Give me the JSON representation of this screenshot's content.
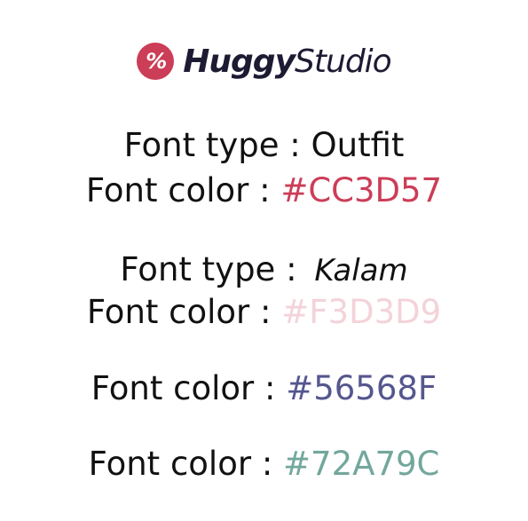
{
  "logo": {
    "icon": "huggy-logo-icon",
    "brand_bold": "Huggy",
    "brand_light": "Studio",
    "accent_color": "#CC3D57"
  },
  "specs": [
    {
      "label": "Font type :",
      "value": "Outfit"
    },
    {
      "label": "Font color :",
      "value": "#CC3D57",
      "color": "#CC3D57"
    },
    {
      "label": "Font type :",
      "value": "Kalam"
    },
    {
      "label": "Font color :",
      "value": "#F3D3D9",
      "color": "#F3D3D9"
    },
    {
      "label": "Font color :",
      "value": "#56568F",
      "color": "#56568F"
    },
    {
      "label": "Font color :",
      "value": "#72A79C",
      "color": "#72A79C"
    }
  ]
}
